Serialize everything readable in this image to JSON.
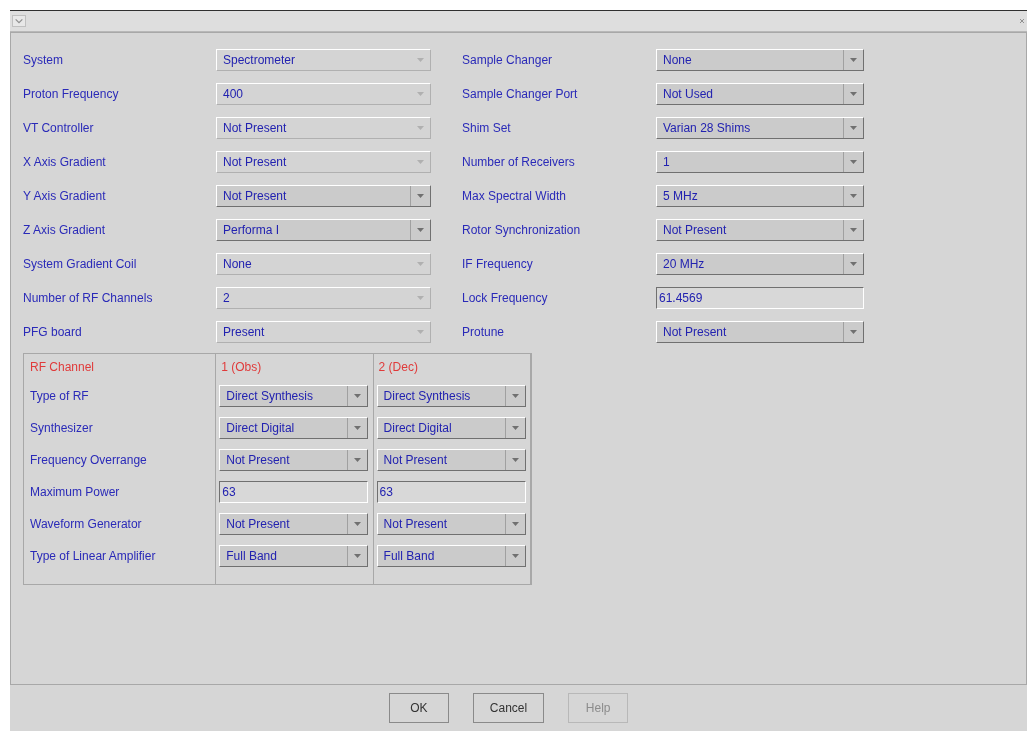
{
  "left_fields": [
    {
      "label": "System",
      "kind": "combo",
      "value": "Spectrometer",
      "disabled": true
    },
    {
      "label": "Proton Frequency",
      "kind": "combo",
      "value": "400",
      "disabled": true
    },
    {
      "label": "VT Controller",
      "kind": "combo",
      "value": "Not Present",
      "disabled": true
    },
    {
      "label": "X Axis Gradient",
      "kind": "combo",
      "value": "Not Present",
      "disabled": true
    },
    {
      "label": "Y Axis Gradient",
      "kind": "combo",
      "value": "Not Present",
      "disabled": false
    },
    {
      "label": "Z Axis Gradient",
      "kind": "combo",
      "value": "Performa I",
      "disabled": false
    },
    {
      "label": "System Gradient Coil",
      "kind": "combo",
      "value": "None",
      "disabled": true
    },
    {
      "label": "Number of RF Channels",
      "kind": "combo",
      "value": "2",
      "disabled": true
    },
    {
      "label": "PFG board",
      "kind": "combo",
      "value": "Present",
      "disabled": true
    }
  ],
  "right_fields": [
    {
      "label": "Sample Changer",
      "kind": "combo",
      "value": "None",
      "disabled": false
    },
    {
      "label": "Sample Changer Port",
      "kind": "combo",
      "value": "Not Used",
      "disabled": false
    },
    {
      "label": "Shim Set",
      "kind": "combo",
      "value": "Varian 28 Shims",
      "disabled": false
    },
    {
      "label": "Number of Receivers",
      "kind": "combo",
      "value": "1",
      "disabled": false
    },
    {
      "label": "Max Spectral Width",
      "kind": "combo",
      "value": "5 MHz",
      "disabled": false
    },
    {
      "label": "Rotor Synchronization",
      "kind": "combo",
      "value": "Not Present",
      "disabled": false
    },
    {
      "label": "IF Frequency",
      "kind": "combo",
      "value": "20 MHz",
      "disabled": false
    },
    {
      "label": "Lock Frequency",
      "kind": "text",
      "value": "61.4569",
      "disabled": false
    },
    {
      "label": "Protune",
      "kind": "combo",
      "value": "Not Present",
      "disabled": false
    }
  ],
  "rf_table": {
    "header_label": "RF Channel",
    "channels": [
      "1 (Obs)",
      "2 (Dec)"
    ],
    "rows": [
      {
        "label": "Type of RF",
        "cells": [
          {
            "kind": "combo",
            "value": "Direct Synthesis",
            "disabled": false
          },
          {
            "kind": "combo",
            "value": "Direct Synthesis",
            "disabled": false
          }
        ]
      },
      {
        "label": "Synthesizer",
        "cells": [
          {
            "kind": "combo",
            "value": "Direct Digital",
            "disabled": false
          },
          {
            "kind": "combo",
            "value": "Direct Digital",
            "disabled": false
          }
        ]
      },
      {
        "label": "Frequency Overrange",
        "cells": [
          {
            "kind": "combo",
            "value": "Not Present",
            "disabled": false
          },
          {
            "kind": "combo",
            "value": "Not Present",
            "disabled": false
          }
        ]
      },
      {
        "label": "Maximum Power",
        "cells": [
          {
            "kind": "text",
            "value": "63",
            "disabled": false
          },
          {
            "kind": "text",
            "value": "63",
            "disabled": false
          }
        ]
      },
      {
        "label": "Waveform Generator",
        "cells": [
          {
            "kind": "combo",
            "value": "Not Present",
            "disabled": false
          },
          {
            "kind": "combo",
            "value": "Not Present",
            "disabled": false
          }
        ]
      },
      {
        "label": "Type of Linear Amplifier",
        "cells": [
          {
            "kind": "combo",
            "value": "Full Band",
            "disabled": false
          },
          {
            "kind": "combo",
            "value": "Full Band",
            "disabled": false
          }
        ]
      }
    ]
  },
  "buttons": [
    {
      "label": "OK",
      "disabled": false
    },
    {
      "label": "Cancel",
      "disabled": false
    },
    {
      "label": "Help",
      "disabled": true
    }
  ]
}
